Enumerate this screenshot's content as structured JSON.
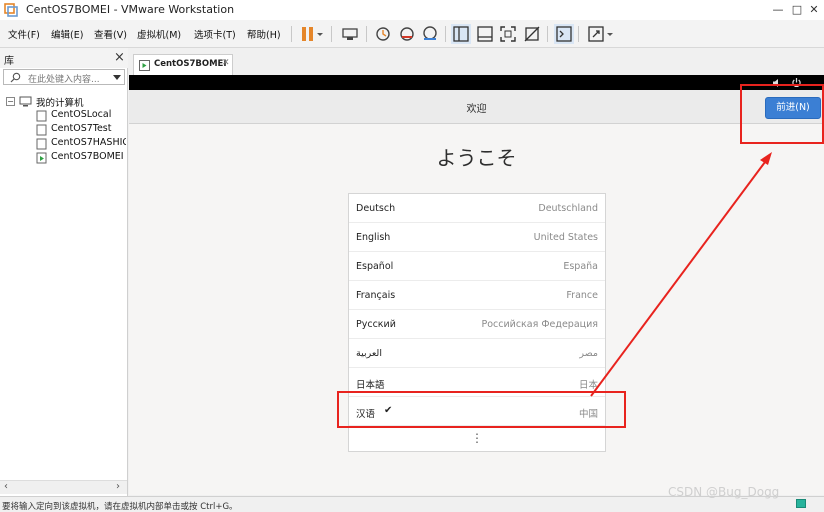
{
  "window": {
    "title": "CentOS7BOMEI - VMware Workstation",
    "controls": [
      "—",
      "□",
      "✕"
    ]
  },
  "menu": {
    "items": [
      "文件(F)",
      "编辑(E)",
      "查看(V)",
      "虚拟机(M)",
      "选项卡(T)",
      "帮助(H)"
    ]
  },
  "library": {
    "title": "库",
    "close": "×",
    "search_placeholder": "在此处键入内容...",
    "root_label": "我的计算机",
    "vms": [
      "CentOSLocal",
      "CentOS7Test",
      "CentOS7HASHIC",
      "CentOS7BOMEI"
    ]
  },
  "vm_tab": {
    "label": "CentOS7BOMEI",
    "close": "✕"
  },
  "installer": {
    "header_title": "欢迎",
    "next_button": "前进(N)",
    "welcome_text": "ようこそ",
    "more": "⋮",
    "languages": [
      {
        "name": "Deutsch",
        "region": "Deutschland",
        "selected": false
      },
      {
        "name": "English",
        "region": "United States",
        "selected": false
      },
      {
        "name": "Español",
        "region": "España",
        "selected": false
      },
      {
        "name": "Français",
        "region": "France",
        "selected": false
      },
      {
        "name": "Русский",
        "region": "Российская Федерация",
        "selected": false
      },
      {
        "name": "العربية",
        "region": "مصر",
        "selected": false
      },
      {
        "name": "日本語",
        "region": "日本",
        "selected": false
      },
      {
        "name": "汉语",
        "region": "中国",
        "selected": true,
        "check": "✔"
      }
    ]
  },
  "status": {
    "text": "要将输入定向到该虚拟机，请在虚拟机内部单击或按 Ctrl+G。"
  },
  "watermark": "CSDN @Bug_Dogg",
  "colors": {
    "accent_button": "#3b7fd4",
    "annotation_red": "#e8231e",
    "pause_orange": "#e5862a"
  }
}
